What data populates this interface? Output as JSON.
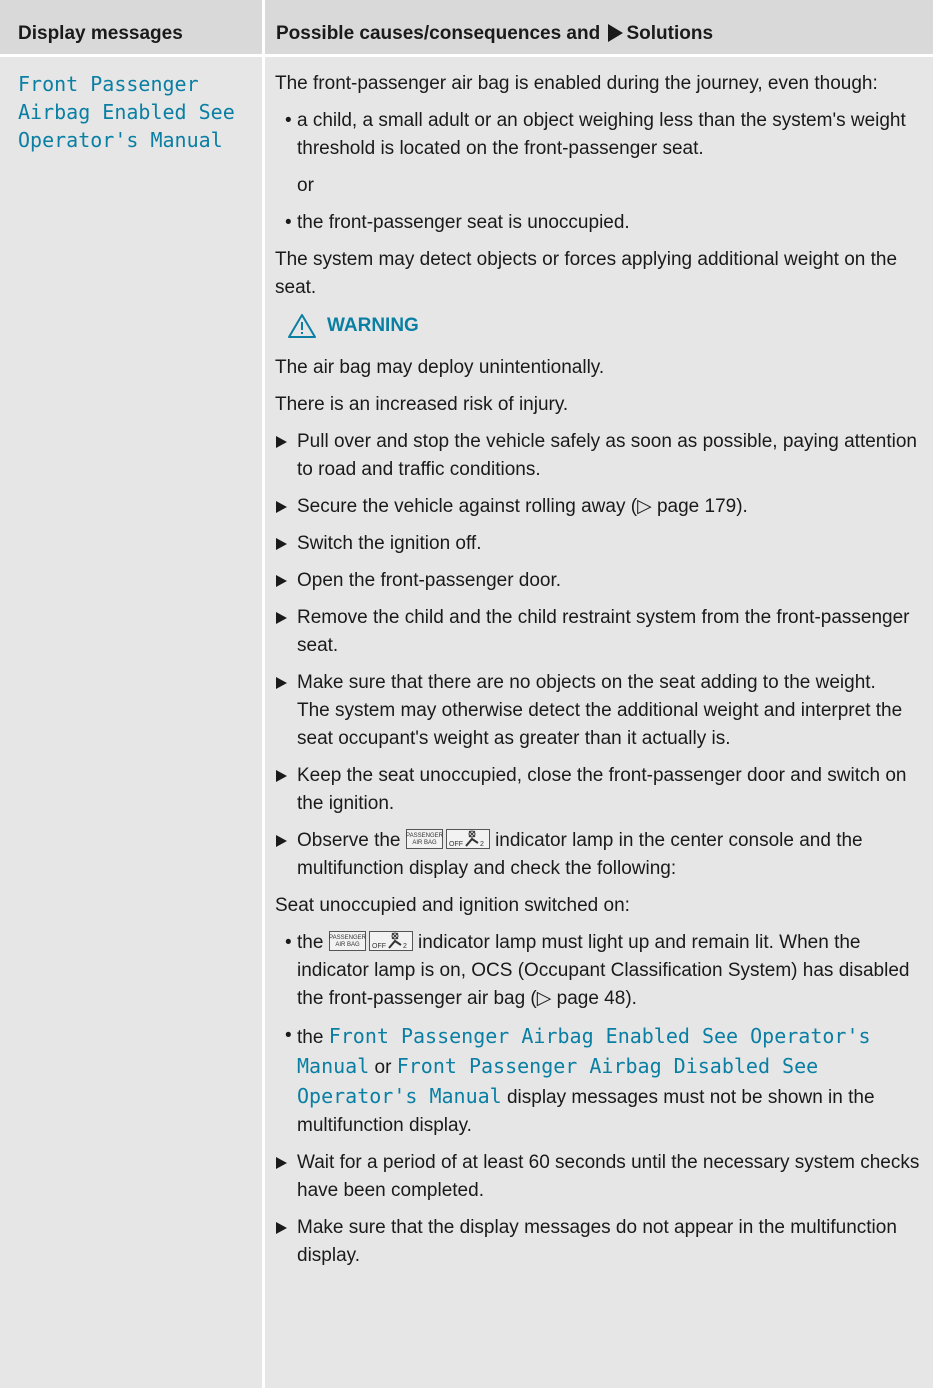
{
  "header": {
    "left_label": "Display messages",
    "right_label_before": "Possible causes/consequences and",
    "right_label_after": "Solutions"
  },
  "row": {
    "message": "Front Passenger Airbag Enabled See Operator's Manual",
    "intro": "The front-passenger air bag is enabled during the journey, even though:",
    "cause1": "a child, a small adult or an object weighing less than the system's weight threshold is located on the front-passenger seat.",
    "or": "or",
    "cause2": "the front-passenger seat is unoccupied.",
    "detect": "The system may detect objects or forces applying additional weight on the seat.",
    "warning_label": "WARNING",
    "warn1": "The air bag may deploy unintentionally.",
    "warn2": "There is an increased risk of injury.",
    "step1": "Pull over and stop the vehicle safely as soon as possible, paying attention to road and traffic conditions.",
    "step2": "Secure the vehicle against rolling away (▷ page 179).",
    "step3": "Switch the ignition off.",
    "step4": "Open the front-passenger door.",
    "step5": "Remove the child and the child restraint system from the front-passenger seat.",
    "step6": "Make sure that there are no objects on the seat adding to the weight.",
    "step6b": "The system may otherwise detect the additional weight and interpret the seat occupant's weight as greater than it actually is.",
    "step7": "Keep the seat unoccupied, close the front-passenger door and switch on the ignition.",
    "step8_before": "Observe the",
    "step8_after": "indicator lamp in the center console and the multifunction display and check the following:",
    "seat_line": "Seat unoccupied and ignition switched on:",
    "check1_before": "the",
    "check1_after": "indicator lamp must light up and remain lit. When the indicator lamp is on, OCS (Occupant Classification System) has disabled the front-passenger air bag (▷ page 48).",
    "check2_the": "the",
    "check2_msg1": "Front Passenger Airbag Enabled See Operator's Manual",
    "check2_or": "or",
    "check2_msg2": "Front Passenger Airbag Disabled See Operator's Manual",
    "check2_after": "display messages must not be shown in the multifunction display.",
    "step9": "Wait for a period of at least 60 seconds until the necessary system checks have been completed.",
    "step10": "Make sure that the display messages do not appear in the multifunction display."
  },
  "icon": {
    "top_text": "PASSENGER",
    "bottom_text": "AIR BAG",
    "off_text": "OFF",
    "sub_text": "2"
  },
  "colors": {
    "accent": "#0a7fa3",
    "header_bg": "#d9d9d9",
    "cell_bg": "#e6e6e6"
  }
}
